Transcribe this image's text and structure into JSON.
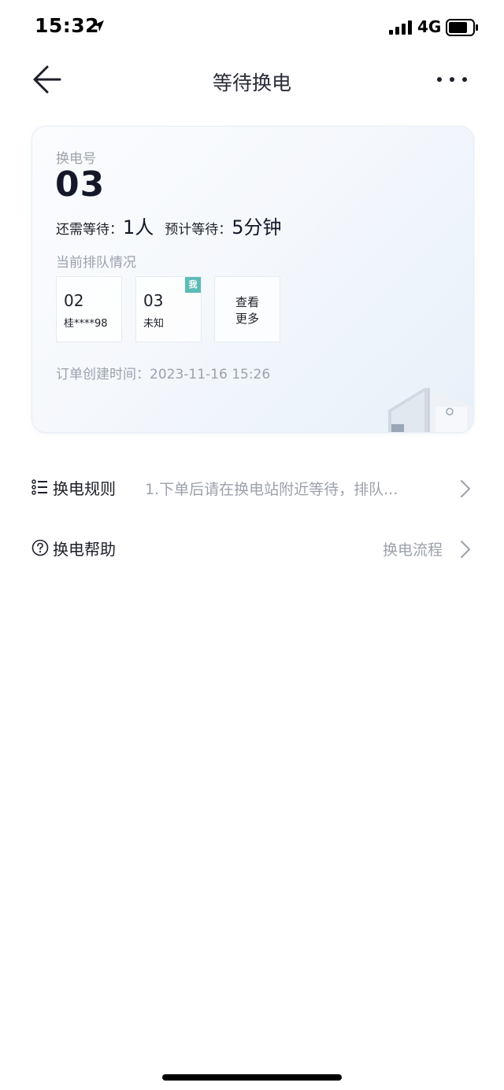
{
  "status_bar": {
    "time": "15:32",
    "network": "4G"
  },
  "nav": {
    "title": "等待换电"
  },
  "card": {
    "swap_no_label": "换电号",
    "swap_no": "03",
    "wait_people_label": "还需等待：",
    "wait_people_value": "1人",
    "wait_time_label": "预计等待：",
    "wait_time_value": "5分钟",
    "queue_label": "当前排队情况",
    "queue": [
      {
        "number": "02",
        "name": "桂****98"
      },
      {
        "number": "03",
        "name": "未知",
        "badge": "我"
      }
    ],
    "more_label": "查看\n更多",
    "order_time_label": "订单创建时间：",
    "order_time": "2023-11-16 15:26"
  },
  "rules_row": {
    "title": "换电规则",
    "value": "1.下单后请在换电站附近等待，排队..."
  },
  "help_row": {
    "title": "换电帮助",
    "value": "换电流程"
  },
  "colors": {
    "badge": "#5dbbb5",
    "muted": "#9ca1ad",
    "text": "#1d1f29"
  }
}
